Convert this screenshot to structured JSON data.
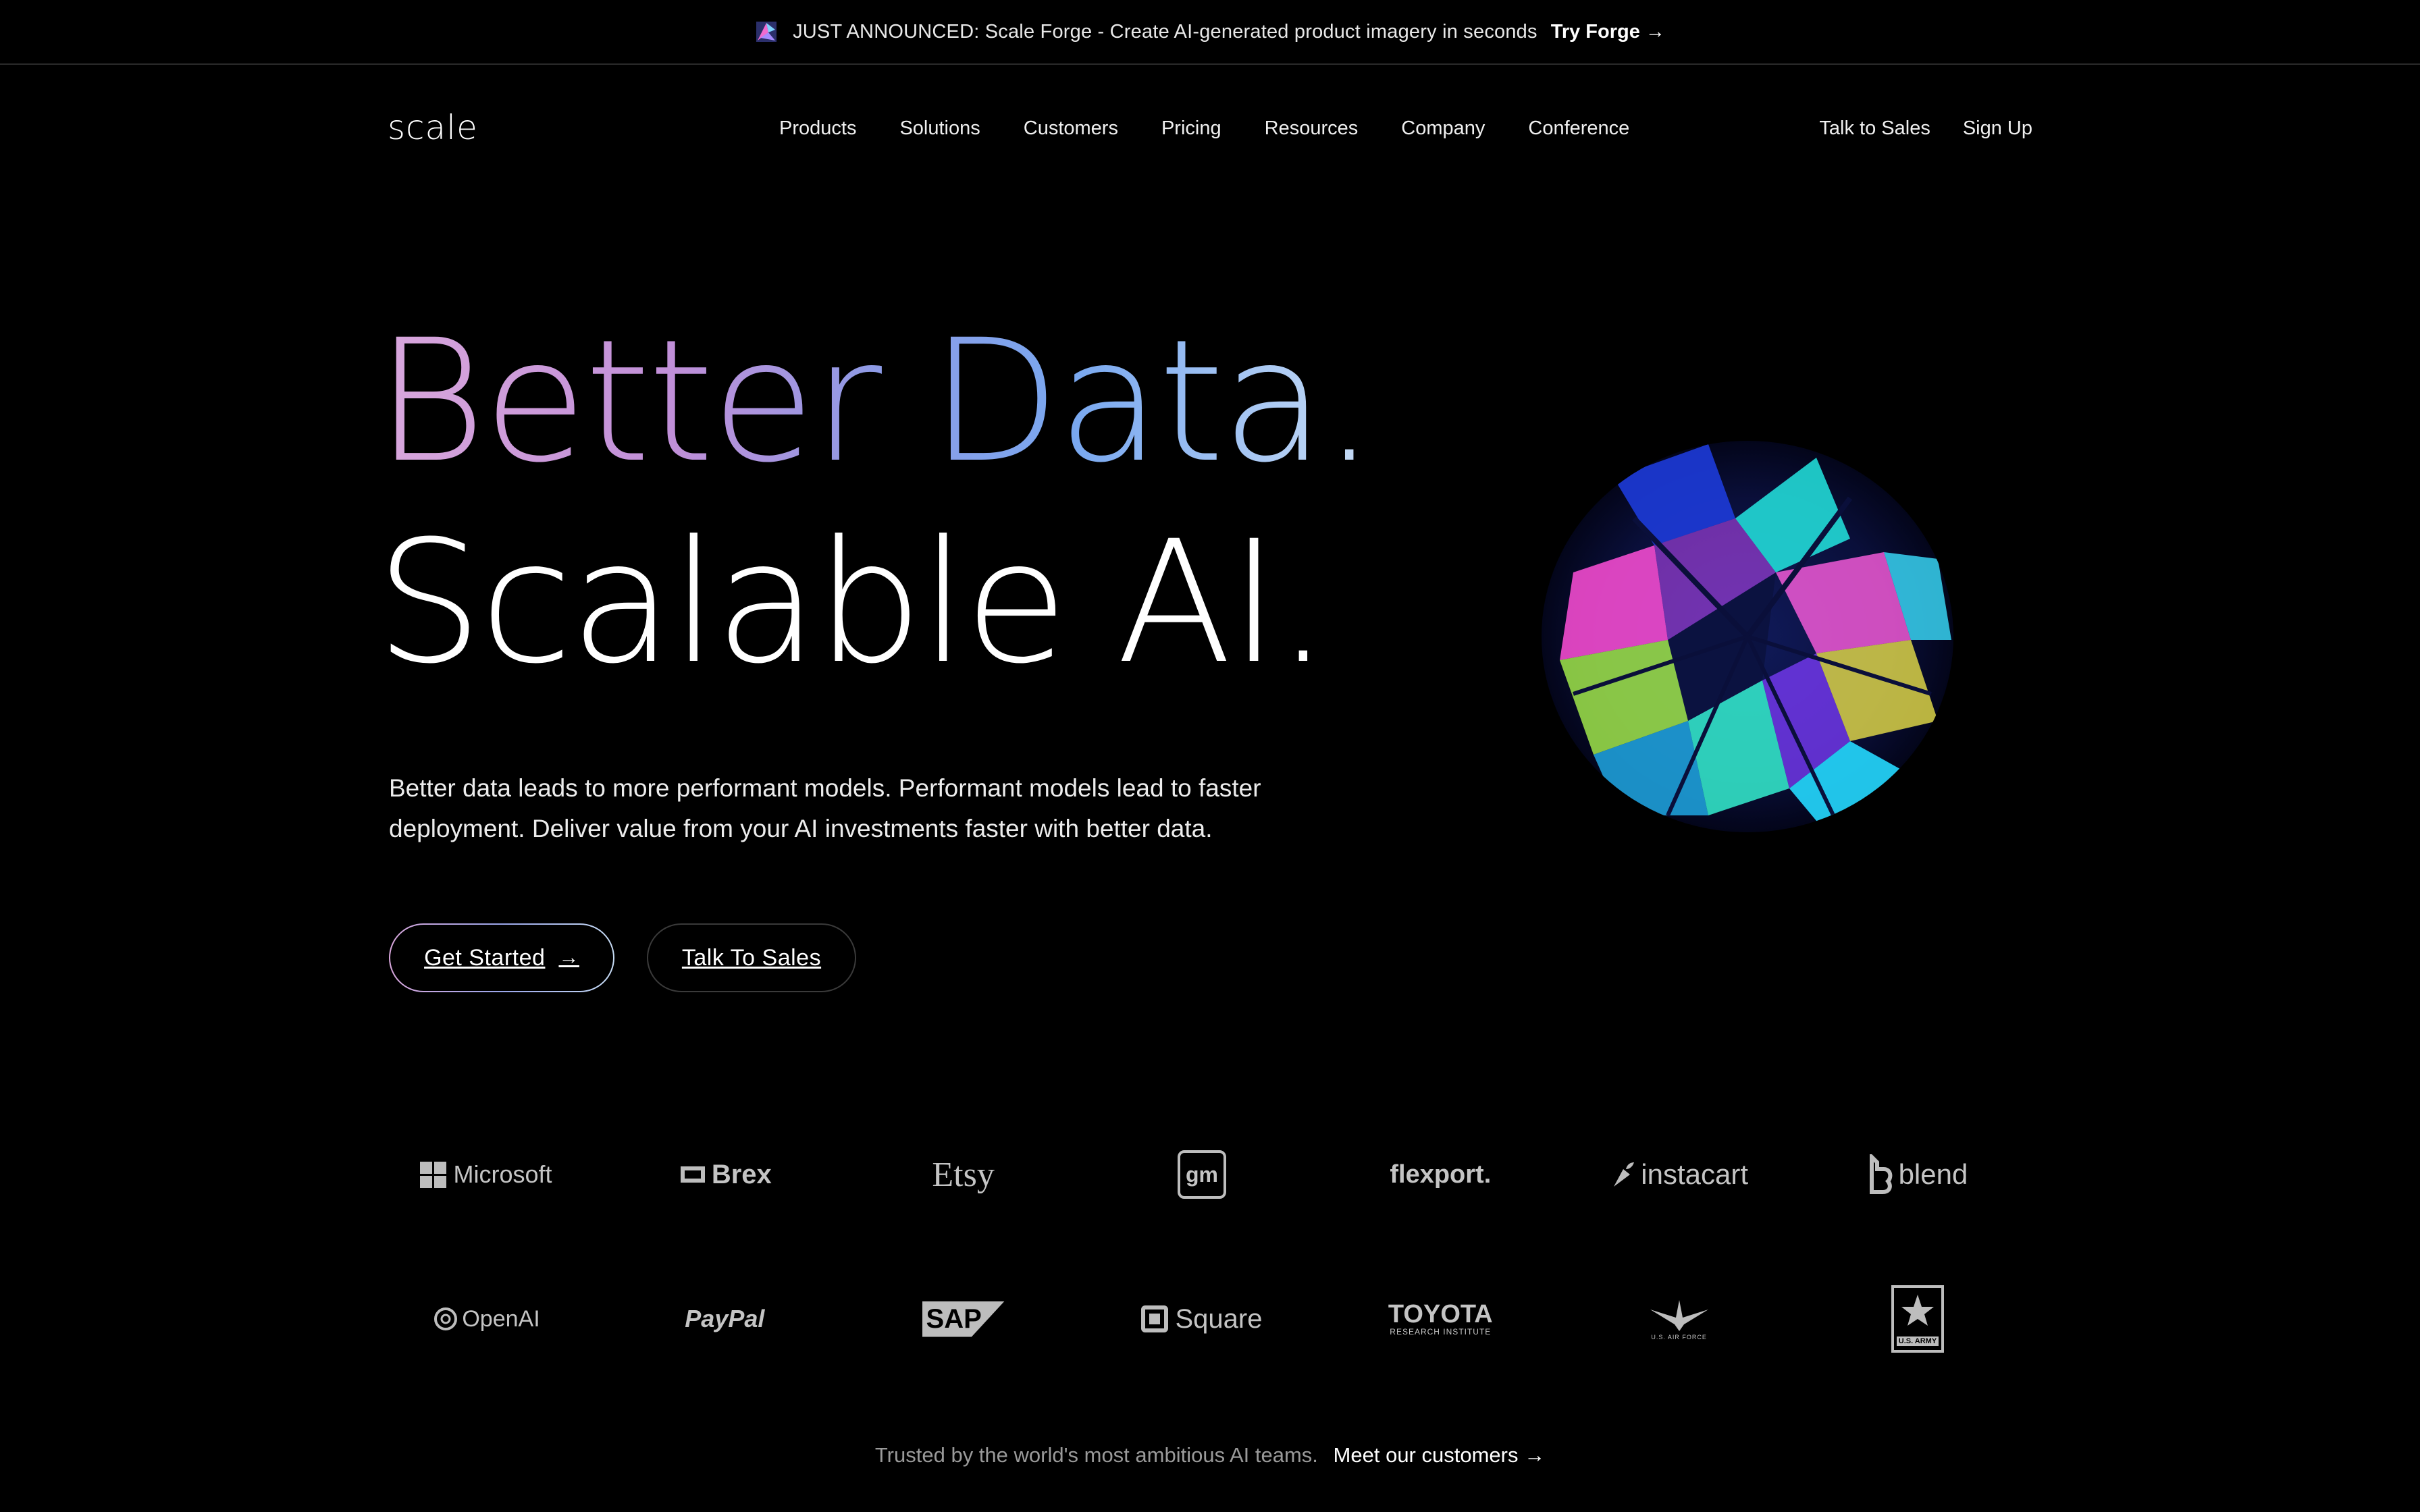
{
  "announcement": {
    "message": "JUST ANNOUNCED: Scale Forge - Create AI-generated product imagery in seconds",
    "cta": "Try Forge →",
    "icon": "sparkle-icon"
  },
  "header": {
    "logo": "scale",
    "nav": [
      "Products",
      "Solutions",
      "Customers",
      "Pricing",
      "Resources",
      "Company",
      "Conference"
    ],
    "right": [
      "Talk to Sales",
      "Sign Up"
    ]
  },
  "hero": {
    "line1": "Better Data.",
    "line2": "Scalable AI.",
    "subtitle": "Better data leads to more performant models. Performant models lead to faster deployment. Deliver value from your AI investments faster with better data.",
    "primary_button": "Get Started",
    "primary_arrow": "→",
    "secondary_button": "Talk To Sales"
  },
  "customers": {
    "row1": [
      "Microsoft",
      "Brex",
      "Etsy",
      "gm",
      "flexport.",
      "instacart",
      "blend"
    ],
    "row2": [
      "OpenAI",
      "PayPal",
      "SAP",
      "Square",
      "TOYOTA",
      "U.S. AIR FORCE",
      "U.S. ARMY"
    ],
    "toyota_sub": "RESEARCH INSTITUTE",
    "trusted_text": "Trusted by the world's most ambitious AI teams.",
    "trusted_link": "Meet our customers →"
  },
  "colors": {
    "background": "#000000",
    "gradient_start": "#d9a7dc",
    "gradient_mid": "#8e9be6",
    "gradient_end": "#c7dcf5"
  }
}
